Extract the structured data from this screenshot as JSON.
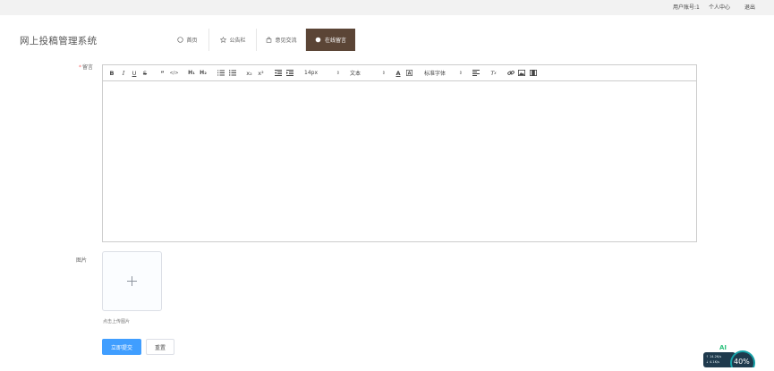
{
  "topbar": {
    "links": [
      "用户账号:1",
      "个人中心",
      "退出"
    ]
  },
  "header": {
    "title": "网上投稿管理系统"
  },
  "nav": {
    "items": [
      {
        "label": "首页",
        "icon": "home-icon"
      },
      {
        "label": "公告栏",
        "icon": "star-icon"
      },
      {
        "label": "意见交流",
        "icon": "bag-icon"
      },
      {
        "label": "在线留言",
        "icon": "dot-icon",
        "active": true
      }
    ]
  },
  "form": {
    "content_label": "留言",
    "image_label": "图片",
    "upload_tip": "点击上传图片",
    "submit_label": "立即提交",
    "reset_label": "重置"
  },
  "toolbar": {
    "font_size": "14px",
    "text_style": "文本",
    "font_family": "标准字体"
  },
  "widget": {
    "percent": "40%",
    "up_speed": "↑ 14.2K/s",
    "down_speed": "↓ 4.1K/s",
    "badge": "AI"
  },
  "colors": {
    "active_nav": "#5b4536",
    "primary": "#409eff"
  }
}
